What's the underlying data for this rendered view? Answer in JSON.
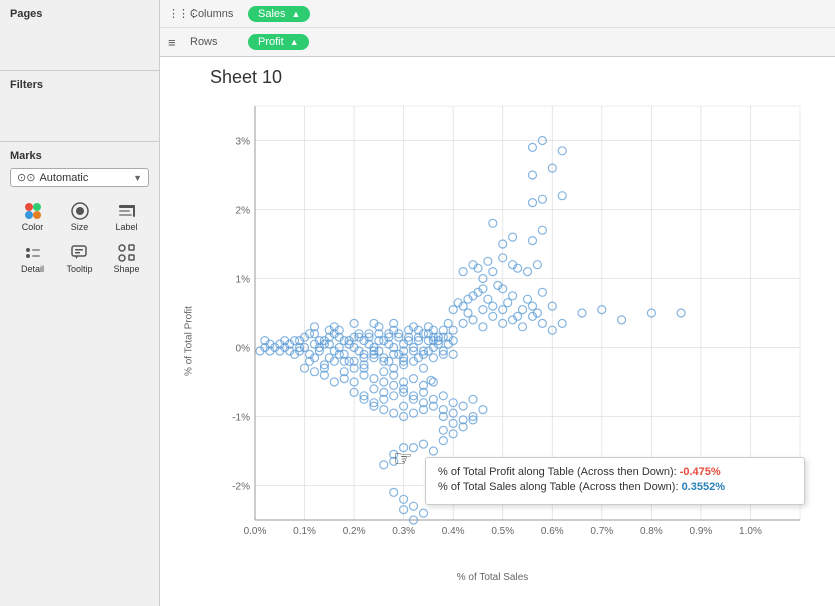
{
  "leftPanel": {
    "pages_label": "Pages",
    "filters_label": "Filters",
    "marks_label": "Marks",
    "marks_dropdown": {
      "icon": "⊙⊙",
      "label": "Automatic",
      "arrow": "▼"
    },
    "marks_buttons": [
      {
        "id": "color",
        "label": "Color"
      },
      {
        "id": "size",
        "label": "Size"
      },
      {
        "id": "label",
        "label": "Label"
      },
      {
        "id": "detail",
        "label": "Detail"
      },
      {
        "id": "tooltip",
        "label": "Tooltip"
      },
      {
        "id": "shape",
        "label": "Shape"
      }
    ]
  },
  "shelf": {
    "columns_icon": "⋮⋮⋮",
    "columns_label": "Columns",
    "columns_pill": "Sales",
    "rows_icon": "≡",
    "rows_label": "Rows",
    "rows_pill": "Profit"
  },
  "chart": {
    "title": "Sheet 10",
    "y_axis_label": "% of Total Profit",
    "x_axis_label": "% of Total Sales",
    "y_ticks": [
      "3%",
      "2%",
      "1%",
      "0%",
      "-1%",
      "-2%"
    ],
    "x_ticks": [
      "0.0%",
      "0.1%",
      "0.2%",
      "0.3%",
      "0.4%",
      "0.5%",
      "0.6%",
      "0.7%",
      "0.8%",
      "0.9%",
      "1.0%"
    ]
  },
  "tooltip": {
    "line1_label": "% of Total Profit along Table (Across then Down): ",
    "line1_value": "-0.475%",
    "line2_label": "% of Total Sales along Table (Across then Down): ",
    "line2_value": "0.3552%"
  },
  "colors": {
    "pill_bg": "#27ae60",
    "dot_blue": "#5b9bd5",
    "accent": "#2ecc71"
  }
}
